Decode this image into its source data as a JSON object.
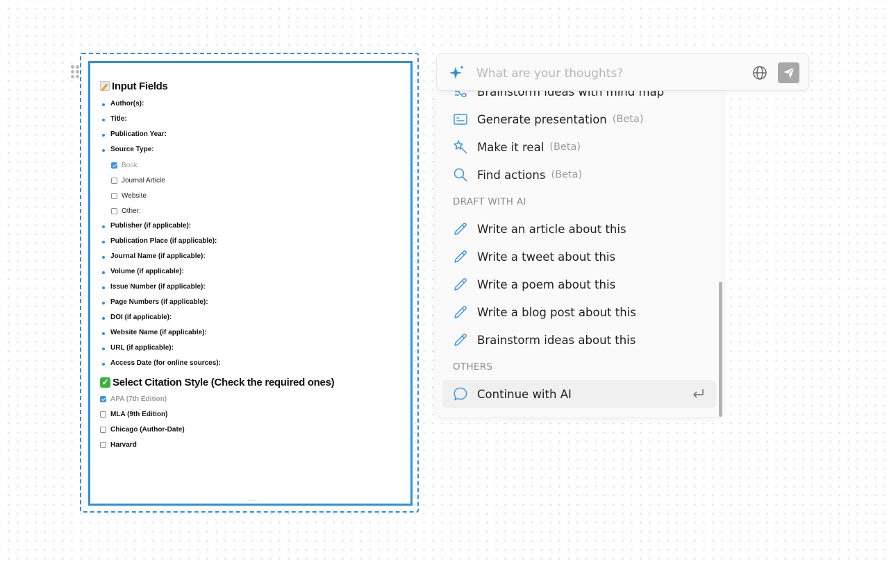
{
  "document": {
    "heading1": {
      "emoji": "memo-icon",
      "text": "Input Fields"
    },
    "fields": [
      "Author(s):",
      "Title:",
      "Publication Year:",
      "Source Type:"
    ],
    "source_types": [
      {
        "label": "Book",
        "checked": true
      },
      {
        "label": "Journal Article",
        "checked": false
      },
      {
        "label": "Website",
        "checked": false
      },
      {
        "label": "Other:",
        "checked": false
      }
    ],
    "more_fields": [
      "Publisher (if applicable):",
      "Publication Place (if applicable):",
      "Journal Name (if applicable):",
      "Volume (if applicable):",
      "Issue Number (if applicable):",
      "Page Numbers (if applicable):",
      "DOI (if applicable):",
      "Website Name (if applicable):",
      "URL (if applicable):",
      "Access Date (for online sources):"
    ],
    "heading2": {
      "emoji": "check-mark-button-icon",
      "text": "Select Citation Style (Check the required ones)"
    },
    "citation_styles": [
      {
        "label": "APA (7th Edition)",
        "checked": true
      },
      {
        "label": "MLA (9th Edition)",
        "checked": false
      },
      {
        "label": "Chicago (Author-Date)",
        "checked": false
      },
      {
        "label": "Harvard",
        "checked": false
      }
    ]
  },
  "ai_bar": {
    "placeholder": "What are your thoughts?",
    "value": "",
    "icons": {
      "left": "sparkle-icon",
      "globe": "globe-icon",
      "send": "send-icon"
    }
  },
  "ai_menu": {
    "items_top": [
      {
        "label": "Brainstorm ideas with mind map",
        "beta": "",
        "icon": "mind-map-icon"
      },
      {
        "label": "Generate presentation",
        "beta": "(Beta)",
        "icon": "presentation-icon"
      },
      {
        "label": "Make it real",
        "beta": "(Beta)",
        "icon": "magic-wand-icon"
      },
      {
        "label": "Find actions",
        "beta": "(Beta)",
        "icon": "search-icon"
      }
    ],
    "section_draft": "DRAFT WITH AI",
    "draft_items": [
      {
        "label": "Write an article about this",
        "icon": "pencil-icon"
      },
      {
        "label": "Write a tweet about this",
        "icon": "pencil-icon"
      },
      {
        "label": "Write a poem about this",
        "icon": "pencil-icon"
      },
      {
        "label": "Write a blog post about this",
        "icon": "pencil-icon"
      },
      {
        "label": "Brainstorm ideas about this",
        "icon": "pencil-icon"
      }
    ],
    "section_others": "OTHERS",
    "others_items": [
      {
        "label": "Continue with AI",
        "icon": "chat-bubble-icon",
        "shortcut": "enter-icon"
      }
    ]
  },
  "colors": {
    "accent": "#2f8fdc",
    "icon_blue": "#3b95e6",
    "send_button": "#a8a8a8",
    "muted_text": "#9a9a9a"
  }
}
